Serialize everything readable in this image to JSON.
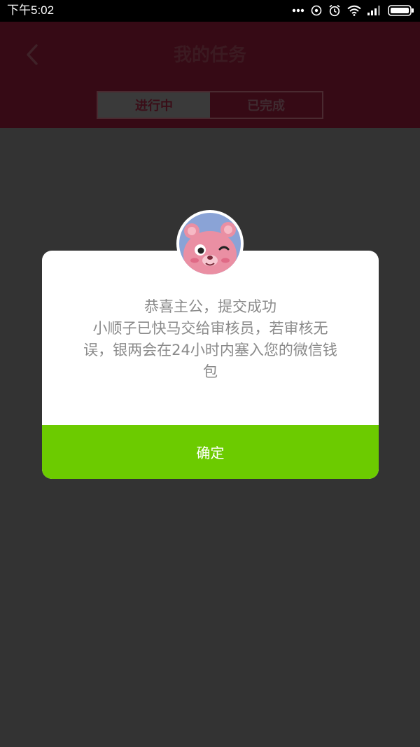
{
  "status_bar": {
    "time": "下午5:02",
    "icons": [
      "more-dots-icon",
      "signal-app-icon",
      "alarm-icon",
      "wifi-icon",
      "cell-signal-icon",
      "battery-icon"
    ]
  },
  "header": {
    "title": "我的任务",
    "back_icon": "back-chevron-icon",
    "tabs": [
      {
        "label": "进行中",
        "active": true
      },
      {
        "label": "已完成",
        "active": false
      }
    ]
  },
  "dialog": {
    "avatar": "bear-avatar",
    "lines": [
      "恭喜主公，提交成功",
      "小顺子已快马交给审核员，若审核无",
      "误，银两会在24小时内塞入您的微信钱",
      "包"
    ],
    "confirm_label": "确定"
  },
  "colors": {
    "confirm_green": "#6ccb00",
    "overlay": "#333333",
    "header_dimmed": "#360a15"
  }
}
